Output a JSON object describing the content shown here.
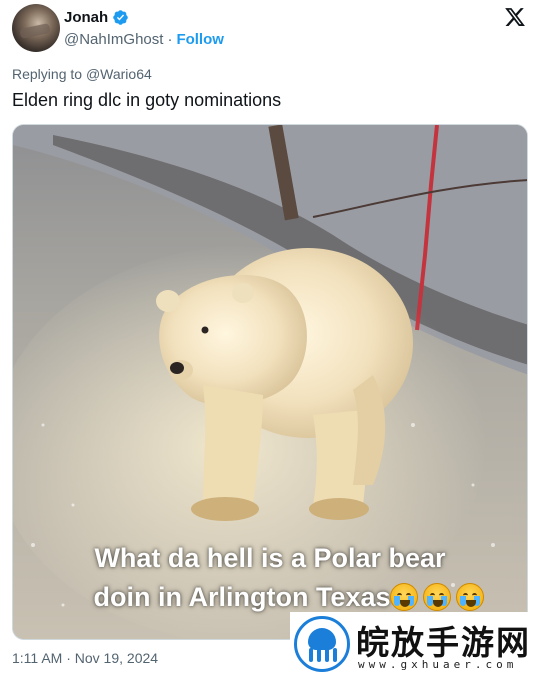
{
  "author": {
    "display_name": "Jonah",
    "handle": "@NahImGhost",
    "separator": "·",
    "follow_label": "Follow",
    "verified": true
  },
  "reply": {
    "prefix": "Replying to",
    "to_handle": "@Wario64"
  },
  "tweet": {
    "text": "Elden ring dlc in goty nominations"
  },
  "media": {
    "caption_line1": "What da hell is a Polar bear",
    "caption_line2": "doin in Arlington Texas",
    "emoji_count": 3,
    "emoji": "loudly-crying-face"
  },
  "meta": {
    "timestamp": "1:11 AM · Nov 19, 2024"
  },
  "watermark": {
    "title": "皖放手游网",
    "url": "www.gxhuaer.com"
  },
  "colors": {
    "accent": "#1d9bf0",
    "secondary_text": "#536471",
    "primary_text": "#0f1419"
  }
}
